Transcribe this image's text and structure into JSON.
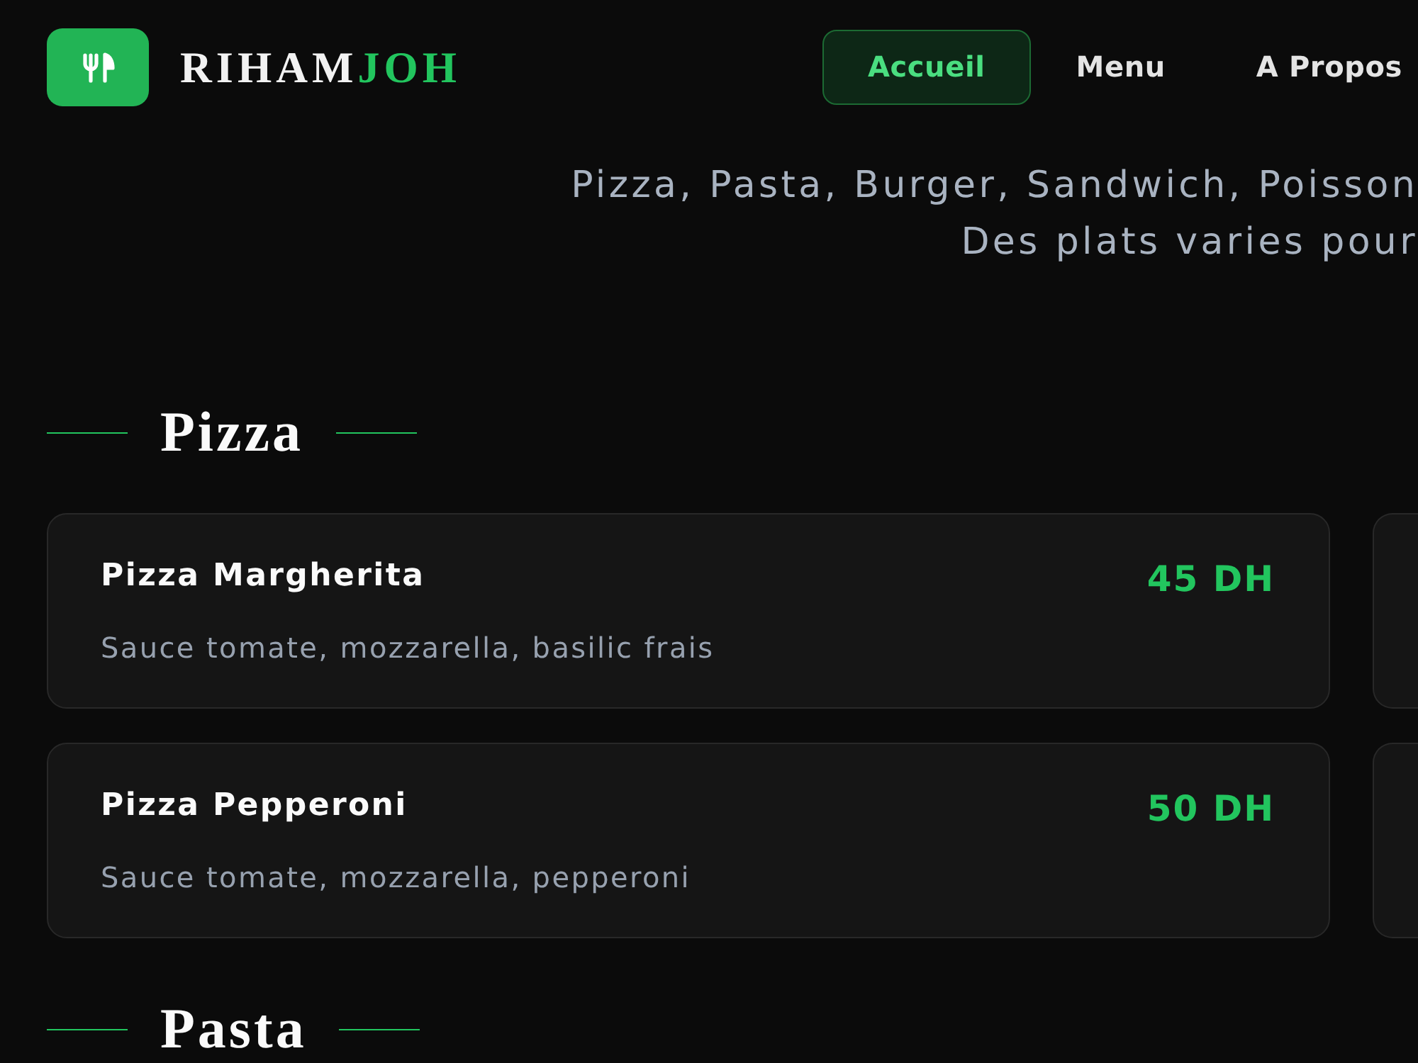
{
  "brand": {
    "name": "RIHAM",
    "accent": "JOH"
  },
  "nav": [
    {
      "label": "Accueil",
      "selected": true
    },
    {
      "label": "Menu",
      "selected": false
    },
    {
      "label": "A Propos",
      "selected": false
    }
  ],
  "intro": [
    "Pizza, Pasta, Burger, Sandwich, Poisson",
    "Des plats varies pour"
  ],
  "sections": [
    {
      "title": "Pizza",
      "items": [
        {
          "name": "Pizza Margherita",
          "description": "Sauce tomate, mozzarella, basilic frais",
          "price": "45 DH"
        },
        {
          "name": "Pizza Pepperoni",
          "description": "Sauce tomate, mozzarella, pepperoni",
          "price": "50 DH"
        }
      ]
    },
    {
      "title": "Pasta"
    }
  ]
}
